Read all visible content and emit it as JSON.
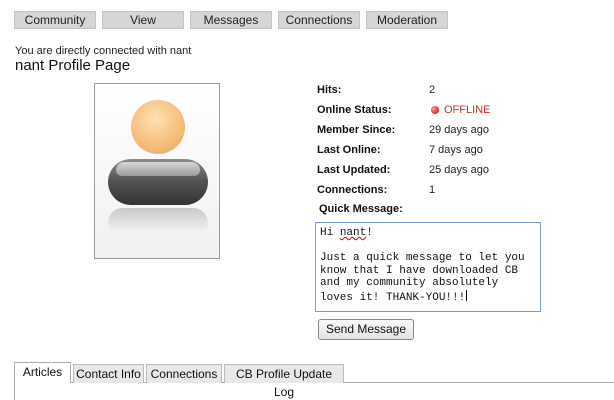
{
  "menu": [
    {
      "label": "Community"
    },
    {
      "label": "View"
    },
    {
      "label": "Messages"
    },
    {
      "label": "Connections"
    },
    {
      "label": "Moderation"
    }
  ],
  "connection_note": "You are directly connected with nant",
  "page_title": "nant Profile Page",
  "avatar": {
    "icon": "default-user-avatar-icon"
  },
  "stats": {
    "hits_label": "Hits:",
    "hits_value": "2",
    "online_label": "Online Status:",
    "online_value": "OFFLINE",
    "online_color": "#c0392b",
    "member_since_label": "Member Since:",
    "member_since_value": "29 days ago",
    "last_online_label": "Last Online:",
    "last_online_value": "7 days ago",
    "last_updated_label": "Last Updated:",
    "last_updated_value": "25 days ago",
    "connections_label": "Connections:",
    "connections_value": "1"
  },
  "quick_message": {
    "label": "Quick Message:",
    "greeting_prefix": "Hi ",
    "greeting_name": "nant",
    "greeting_suffix": "!",
    "line_1": "Just a quick message to let you",
    "line_2": "know that I have downloaded CB",
    "line_3": "and my community absolutely",
    "line_4": "loves it! THANK-YOU!!!",
    "button_label": "Send Message"
  },
  "tabs": [
    {
      "label": "Articles",
      "active": true
    },
    {
      "label": "Contact Info",
      "active": false
    },
    {
      "label": "Connections",
      "active": false
    },
    {
      "label": "CB Profile Update Log",
      "active": false
    }
  ]
}
